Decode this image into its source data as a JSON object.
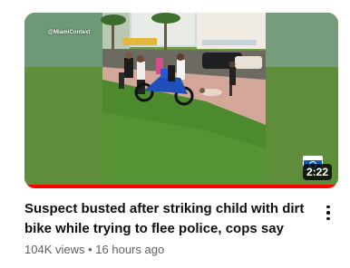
{
  "video": {
    "title": "Suspect busted after striking child with dirt bike while trying to flee police, cops say",
    "views": "104K views",
    "separator": "•",
    "age": "16 hours ago",
    "duration": "2:22",
    "watermark": "@MiamiContext",
    "watch_progress": 1.0
  },
  "icons": {
    "menu": "more-vert-icon",
    "channel": "local-news-logo-icon"
  },
  "colors": {
    "progress": "#ff0000",
    "duration_bg": "#000000",
    "title": "#0f0f0f",
    "meta": "#606060",
    "badge": "#0a5fb4"
  }
}
